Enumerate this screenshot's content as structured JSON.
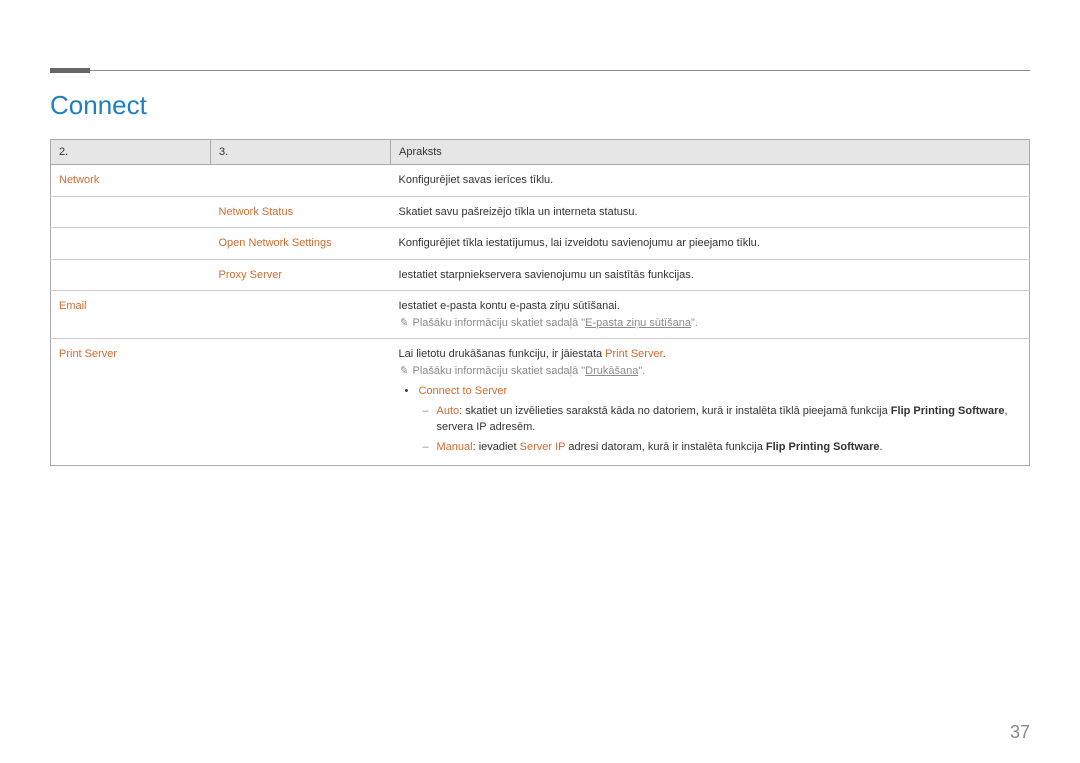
{
  "title": "Connect",
  "header": {
    "c1": "2.",
    "c2": "3.",
    "c3": "Apraksts"
  },
  "rows": {
    "network": {
      "label": "Network",
      "desc": "Konfigurējiet savas ierīces tīklu."
    },
    "network_status": {
      "label": "Network Status",
      "desc": "Skatiet savu pašreizējo tīkla un interneta statusu."
    },
    "open_network": {
      "label": "Open Network Settings",
      "desc": "Konfigurējiet tīkla iestatījumus, lai izveidotu savienojumu ar pieejamo tīklu."
    },
    "proxy": {
      "label": "Proxy Server",
      "desc": "Iestatiet starpniekservera savienojumu un saistītās funkcijas."
    },
    "email": {
      "label": "Email",
      "desc": "Iestatiet e-pasta kontu e-pasta ziņu sūtīšanai.",
      "note_prefix": "Plašāku informāciju skatiet sadaļā \"",
      "note_link": "E-pasta ziņu sūtīšana",
      "note_suffix": "\"."
    },
    "print": {
      "label": "Print Server",
      "desc_prefix": "Lai lietotu drukāšanas funkciju, ir jāiestata ",
      "desc_orange": "Print Server",
      "desc_suffix": ".",
      "note_prefix": "Plašāku informāciju skatiet sadaļā \"",
      "note_link": "Drukāšana",
      "note_suffix": "\".",
      "connect_label": "Connect to Server",
      "auto_label": "Auto",
      "auto_text": ": skatiet un izvēlieties sarakstā kāda no datoriem, kurā ir instalēta tīklā pieejamā funkcija ",
      "auto_bold": "Flip Printing Software",
      "auto_tail": ", servera IP adresēm.",
      "manual_label": "Manual",
      "manual_text1": ": ievadiet ",
      "manual_orange": "Server IP",
      "manual_text2": " adresi datoram, kurā ir instalēta funkcija ",
      "manual_bold": "Flip Printing Software",
      "manual_tail": "."
    }
  },
  "page_number": "37"
}
